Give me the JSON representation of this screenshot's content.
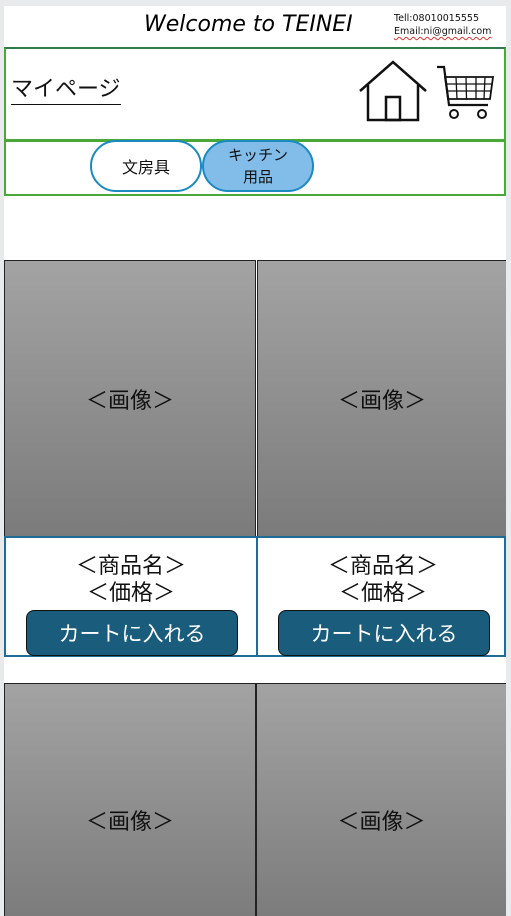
{
  "header": {
    "title": "Welcome to TEINEI",
    "tel": "Tell:08010015555",
    "email": "Email:ni@gmail.com"
  },
  "nav": {
    "mypage_label": "マイページ",
    "home_icon": "home-icon",
    "cart_icon": "cart-icon"
  },
  "categories": [
    {
      "label": "文房具"
    },
    {
      "label_line1": "キッチン",
      "label_line2": "用品"
    }
  ],
  "products": [
    {
      "image_placeholder": "＜画像＞",
      "name": "＜商品名＞",
      "price": "＜価格＞",
      "button": "カートに入れる"
    },
    {
      "image_placeholder": "＜画像＞",
      "name": "＜商品名＞",
      "price": "＜価格＞",
      "button": "カートに入れる"
    },
    {
      "image_placeholder": "＜画像＞"
    },
    {
      "image_placeholder": "＜画像＞"
    }
  ],
  "colors": {
    "accent_green": "#4aa839",
    "pill_border": "#1a8ac0",
    "pill_active_bg": "#82bde9",
    "cart_button_bg": "#1a5c7c"
  }
}
